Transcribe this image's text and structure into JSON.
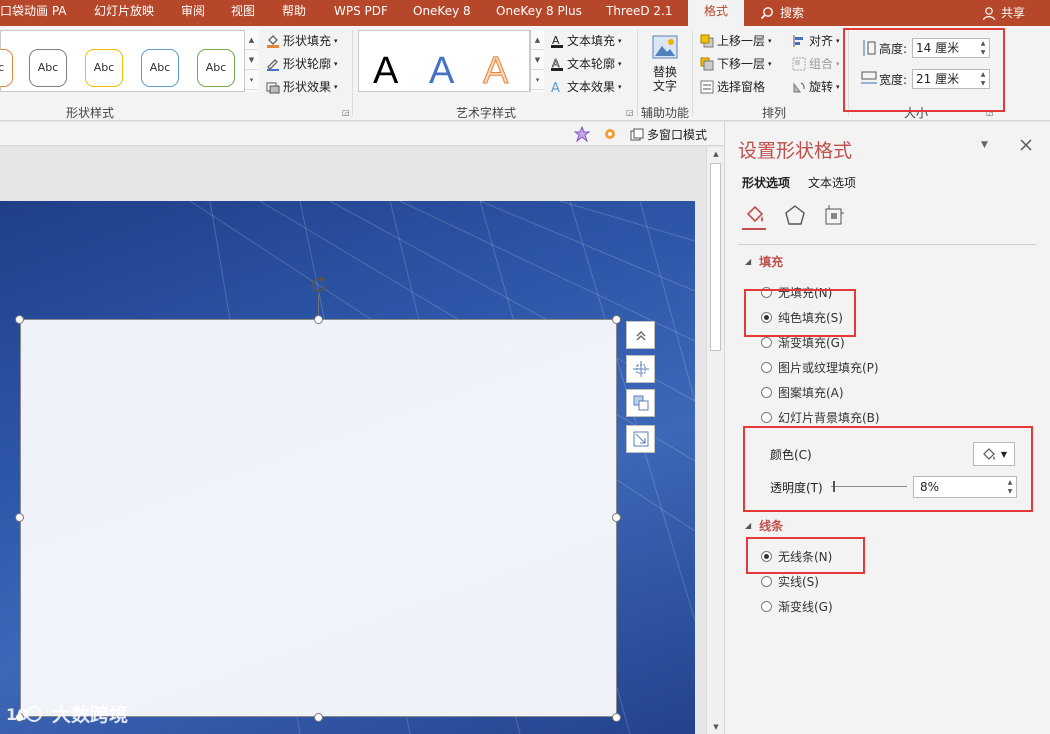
{
  "tabs": [
    {
      "label": "口袋动画 PA"
    },
    {
      "label": "幻灯片放映"
    },
    {
      "label": "审阅"
    },
    {
      "label": "视图"
    },
    {
      "label": "帮助"
    },
    {
      "label": "WPS PDF"
    },
    {
      "label": "OneKey 8"
    },
    {
      "label": "OneKey 8 Plus"
    },
    {
      "label": "ThreeD 2.1"
    }
  ],
  "active_tab": "格式",
  "search_label": "搜索",
  "share_label": "共享",
  "ribbon": {
    "shape_styles": {
      "thumb_label": "Abc",
      "fill": "形状填充",
      "outline": "形状轮廓",
      "effect": "形状效果",
      "group_label": "形状样式"
    },
    "wordart": {
      "letter": "A",
      "text_fill": "文本填充",
      "text_outline": "文本轮廓",
      "text_effect": "文本效果",
      "group_label": "艺术字样式"
    },
    "accessibility": {
      "alt_text_line1": "替换",
      "alt_text_line2": "文字",
      "group_label": "辅助功能"
    },
    "arrange": {
      "bring_forward": "上移一层",
      "send_backward": "下移一层",
      "selection_pane": "选择窗格",
      "align": "对齐",
      "group": "组合",
      "rotate": "旋转",
      "group_label": "排列"
    },
    "size": {
      "height_label": "高度:",
      "height_value": "14 厘米",
      "width_label": "宽度:",
      "width_value": "21 厘米",
      "group_label": "大小"
    }
  },
  "subbar": {
    "multi_window": "多窗口模式"
  },
  "pane": {
    "title": "设置形状格式",
    "tab_shape": "形状选项",
    "tab_text": "文本选项",
    "fill_section": "填充",
    "fill_options": [
      {
        "label": "无填充(N)",
        "selected": false
      },
      {
        "label": "纯色填充(S)",
        "selected": true
      },
      {
        "label": "渐变填充(G)",
        "selected": false
      },
      {
        "label": "图片或纹理填充(P)",
        "selected": false
      },
      {
        "label": "图案填充(A)",
        "selected": false
      },
      {
        "label": "幻灯片背景填充(B)",
        "selected": false
      }
    ],
    "color_label": "颜色(C)",
    "transparency_label": "透明度(T)",
    "transparency_value": "8%",
    "line_section": "线条",
    "line_options": [
      {
        "label": "无线条(N)",
        "selected": true
      },
      {
        "label": "实线(S)",
        "selected": false
      },
      {
        "label": "渐变线(G)",
        "selected": false
      }
    ]
  },
  "watermark": "大数跨境",
  "colors": {
    "accent": "#b7472a",
    "pane_title": "#c0504d",
    "highlight_box": "#e53935"
  }
}
